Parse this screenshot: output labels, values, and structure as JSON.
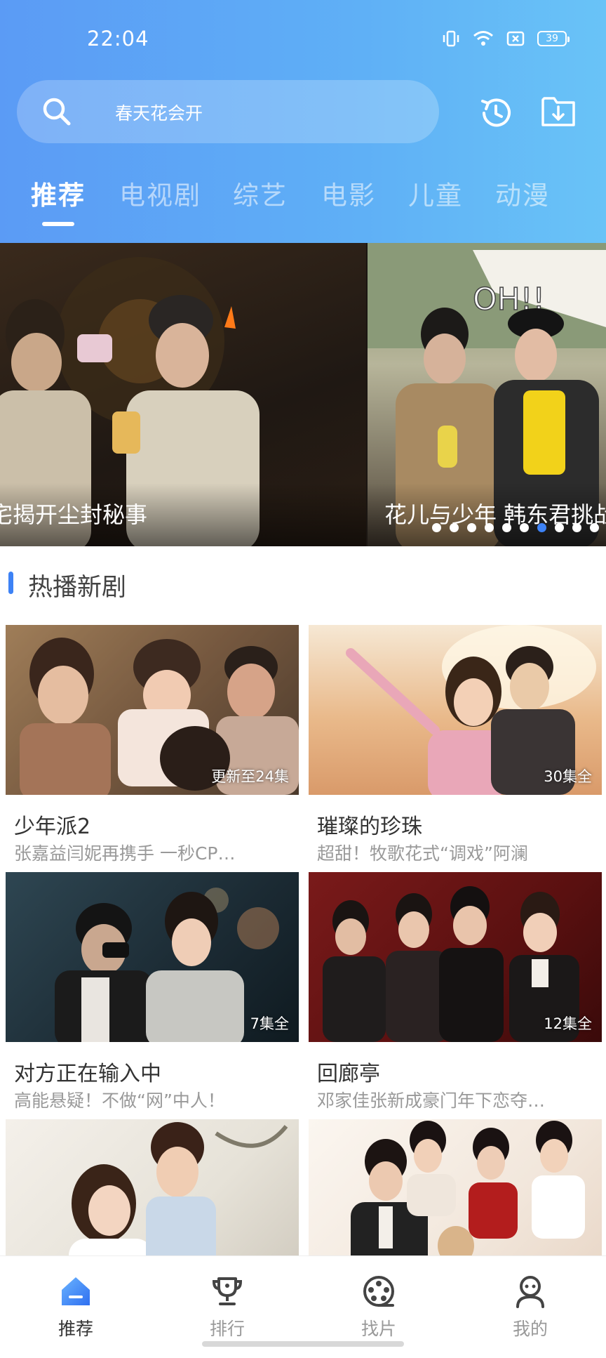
{
  "status_bar": {
    "time": "22:04",
    "battery": "39"
  },
  "search": {
    "placeholder": "春天花会开"
  },
  "tabs": [
    {
      "label": "推荐"
    },
    {
      "label": "电视剧"
    },
    {
      "label": "综艺"
    },
    {
      "label": "电影"
    },
    {
      "label": "儿童"
    },
    {
      "label": "动漫"
    }
  ],
  "active_tab": "推荐",
  "banner": {
    "slides": [
      {
        "caption": "宅揭开尘封秘事"
      },
      {
        "caption": "花儿与少年 韩东君挑战"
      }
    ],
    "dot_count": 10,
    "active_dot": 7
  },
  "section": {
    "title": "热播新剧"
  },
  "cards": [
    {
      "title": "少年派2",
      "subtitle": "张嘉益闫妮再携手 一秒CP…",
      "badge": "更新至24集"
    },
    {
      "title": "璀璨的珍珠",
      "subtitle": "超甜！牧歌花式“调戏”阿澜",
      "badge": "30集全"
    },
    {
      "title": "对方正在输入中",
      "subtitle": "高能悬疑！不做“网”中人！",
      "badge": "7集全"
    },
    {
      "title": "回廊亭",
      "subtitle": "邓家佳张新成豪门年下恋夺…",
      "badge": "12集全"
    },
    {
      "title": "",
      "subtitle": "",
      "badge": ""
    },
    {
      "title": "",
      "subtitle": "",
      "badge": ""
    }
  ],
  "bottom_nav": [
    {
      "label": "推荐",
      "icon": "home-icon"
    },
    {
      "label": "排行",
      "icon": "trophy-icon"
    },
    {
      "label": "找片",
      "icon": "film-reel-icon"
    },
    {
      "label": "我的",
      "icon": "profile-icon"
    }
  ],
  "colors": {
    "accent": "#3d82f5",
    "header_start": "#5b9bf5",
    "header_end": "#69c3f7"
  }
}
